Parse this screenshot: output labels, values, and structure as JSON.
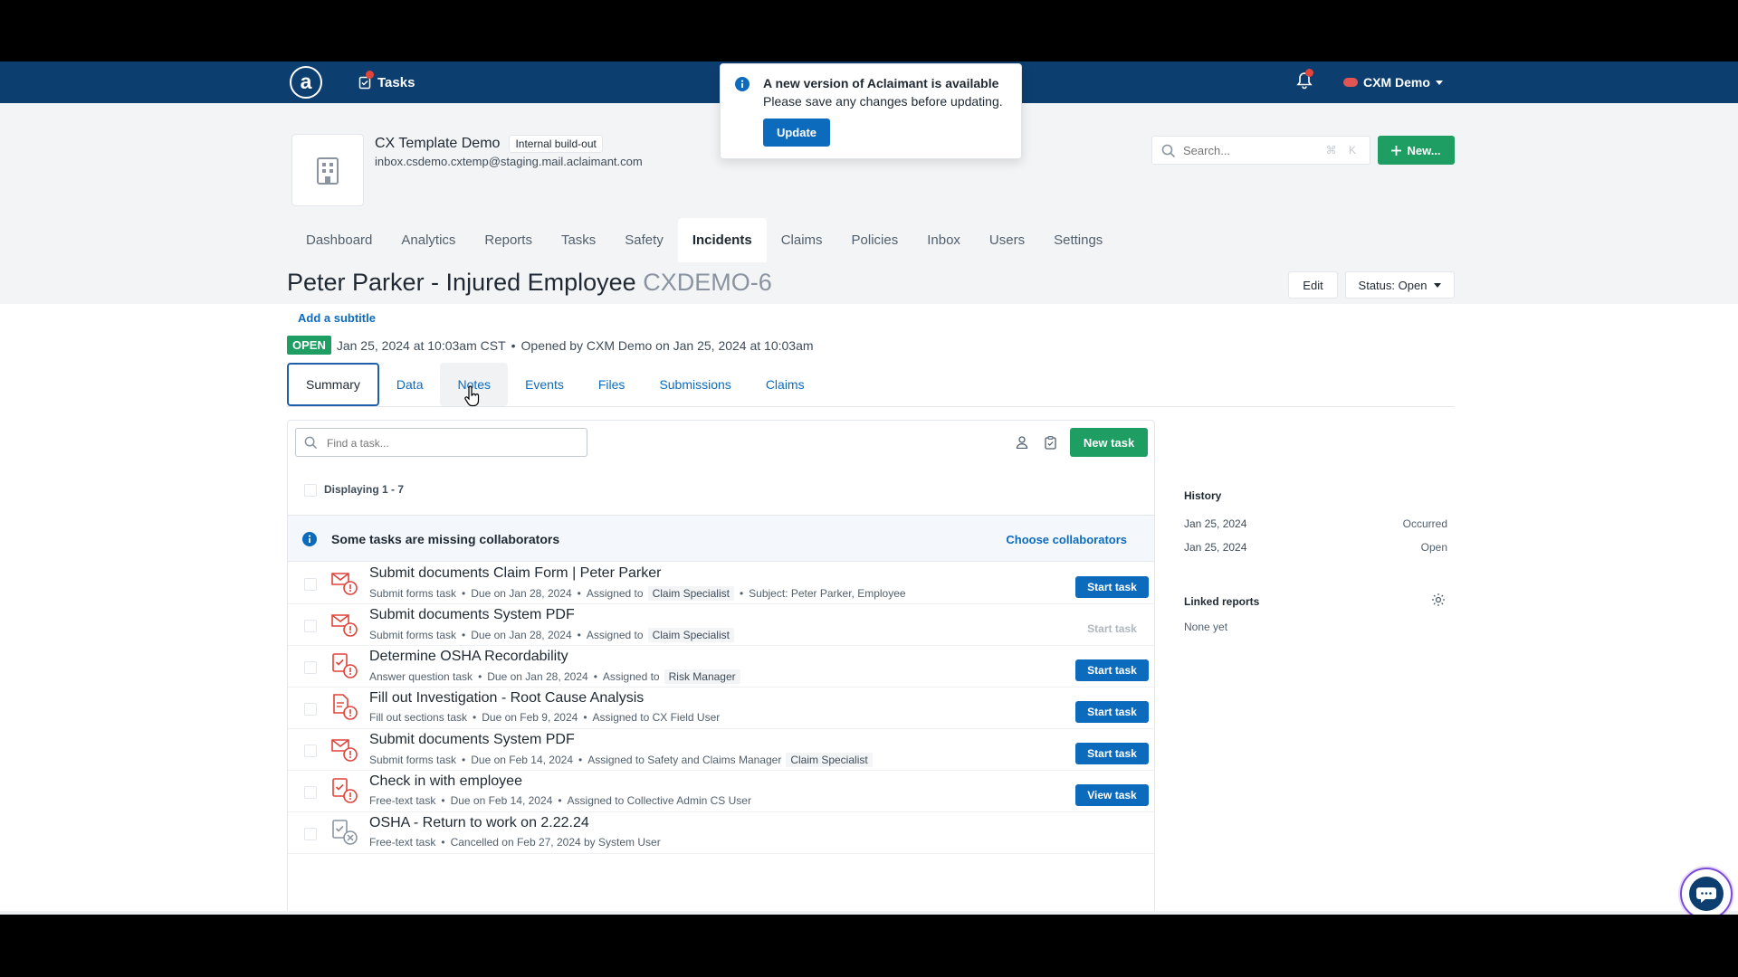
{
  "topnav": {
    "logo": "a",
    "tasks_label": "Tasks",
    "user_label": "CXM Demo"
  },
  "popup": {
    "title": "A new version of Aclaimant is available",
    "message": "Please save any changes before updating.",
    "button": "Update"
  },
  "company": {
    "name": "CX Template Demo",
    "tag": "Internal build-out",
    "email": "inbox.csdemo.cxtemp@staging.mail.aclaimant.com"
  },
  "search": {
    "placeholder": "Search...",
    "shortcut": "⌘ K"
  },
  "new_button": "New...",
  "main_tabs": [
    "Dashboard",
    "Analytics",
    "Reports",
    "Tasks",
    "Safety",
    "Incidents",
    "Claims",
    "Policies",
    "Inbox",
    "Users",
    "Settings"
  ],
  "active_main_tab": "Incidents",
  "incident": {
    "title": "Peter Parker - Injured Employee",
    "ref": "CXDEMO-6",
    "add_subtitle": "Add a subtitle",
    "status_badge": "OPEN",
    "occurred": "Jan 25, 2024 at 10:03am CST",
    "opened_by": "Opened by CXM Demo on Jan 25, 2024 at 10:03am",
    "edit_label": "Edit",
    "status_label": "Status: Open"
  },
  "sub_tabs": [
    "Summary",
    "Data",
    "Notes",
    "Events",
    "Files",
    "Submissions",
    "Claims"
  ],
  "tasks": {
    "find_placeholder": "Find a task...",
    "new_task": "New task",
    "displaying": "Displaying 1 - 7",
    "banner_message": "Some tasks are missing collaborators",
    "banner_link": "Choose collaborators",
    "rows": [
      {
        "title": "Submit documents Claim Form | Peter Parker",
        "type": "Submit forms task",
        "due": "Due on Jan 28, 2024",
        "assigned": "Assigned to",
        "pill": "Claim Specialist",
        "extra": "Subject: Peter Parker, Employee",
        "button": "Start task",
        "enabled": true
      },
      {
        "title": "Submit documents System PDF",
        "type": "Submit forms task",
        "due": "Due on Jan 28, 2024",
        "assigned": "Assigned to",
        "pill": "Claim Specialist",
        "extra": "",
        "button": "Start task",
        "enabled": false
      },
      {
        "title": "Determine OSHA Recordability",
        "type": "Answer question task",
        "due": "Due on Jan 28, 2024",
        "assigned": "Assigned to",
        "pill": "Risk Manager",
        "extra": "",
        "button": "Start task",
        "enabled": true
      },
      {
        "title": "Fill out Investigation - Root Cause Analysis",
        "type": "Fill out sections task",
        "due": "Due on Feb 9, 2024",
        "assigned": "Assigned to CX Field User",
        "pill": "",
        "extra": "",
        "button": "Start task",
        "enabled": true
      },
      {
        "title": "Submit documents System PDF",
        "type": "Submit forms task",
        "due": "Due on Feb 14, 2024",
        "assigned": "Assigned to Safety and Claims Manager",
        "pill": "Claim Specialist",
        "extra": "",
        "button": "Start task",
        "enabled": true
      },
      {
        "title": "Check in with employee",
        "type": "Free-text task",
        "due": "Due on Feb 14, 2024",
        "assigned": "Assigned to Collective Admin CS User",
        "pill": "",
        "extra": "",
        "button": "View task",
        "enabled": true
      },
      {
        "title": "OSHA - Return to work on 2.22.24",
        "type": "Free-text task",
        "due": "Cancelled on Feb 27, 2024 by System User",
        "assigned": "",
        "pill": "",
        "extra": "",
        "button": "",
        "enabled": false
      }
    ]
  },
  "sidebar": {
    "history_title": "History",
    "history": [
      {
        "date": "Jan 25, 2024",
        "label": "Occurred"
      },
      {
        "date": "Jan 25, 2024",
        "label": "Open"
      }
    ],
    "linked_title": "Linked reports",
    "linked_empty": "None yet"
  },
  "colors": {
    "nav": "#0c3e70",
    "primary": "#0d6bbd",
    "success": "#1e9e63",
    "alert": "#e0443a"
  }
}
